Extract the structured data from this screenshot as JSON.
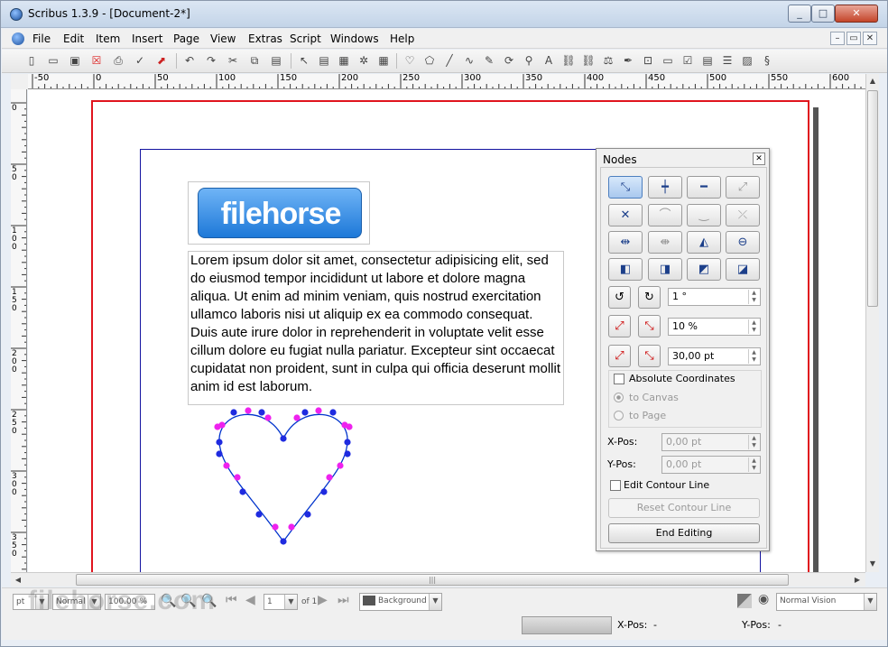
{
  "window": {
    "title": "Scribus 1.3.9 - [Document-2*]",
    "controls": [
      "_",
      "□",
      "✕"
    ]
  },
  "menubar": {
    "items": [
      "File",
      "Edit",
      "Item",
      "Insert",
      "Page",
      "View",
      "Extras",
      "Script",
      "Windows",
      "Help"
    ],
    "mdi": [
      "–",
      "▭",
      "✕"
    ]
  },
  "toolbar": {
    "icons": [
      "new-icon",
      "open-icon",
      "save-icon",
      "close-icon",
      "print-icon",
      "preflight-icon",
      "pdf-icon",
      "undo-icon",
      "redo-icon",
      "cut-icon",
      "copy-icon",
      "paste-icon",
      "select-icon",
      "text-frame-icon",
      "image-frame-icon",
      "render-frame-icon",
      "table-icon",
      "shape-icon",
      "polygon-icon",
      "line-icon",
      "bezier-icon",
      "freehand-icon",
      "rotate-icon",
      "zoom-icon",
      "edit-text-icon",
      "link-icon",
      "unlink-icon",
      "measure-icon",
      "eyedropper-icon",
      "pdf-button-icon",
      "pdf-textfield-icon",
      "pdf-checkbox-icon",
      "pdf-combo-icon",
      "pdf-list-icon",
      "pdf-annotation-icon",
      "pdf-link-icon"
    ]
  },
  "ruler": {
    "h_labels": [
      "-50",
      "0",
      "50",
      "100",
      "150",
      "200",
      "250",
      "300",
      "350",
      "400",
      "450",
      "500",
      "550",
      "600"
    ],
    "v_labels": [
      "0",
      "50",
      "100",
      "150",
      "200",
      "250",
      "300",
      "350"
    ]
  },
  "document": {
    "text": "Lorem ipsum dolor sit amet, consectetur adipisicing elit, sed do eiusmod tempor incididunt ut labore et dolore magna aliqua. Ut enim ad minim veniam, quis nostrud exercitation ullamco laboris nisi ut aliquip ex ea commodo consequat. Duis aute irure dolor in reprehenderit in voluptate velit esse cillum dolore eu fugiat nulla pariatur. Excepteur sint occaecat cupidatat non proident, sunt in culpa qui officia deserunt mollit anim id est laborum.",
    "logo_text": "filehorse"
  },
  "nodes_panel": {
    "title": "Nodes",
    "rotate_value": "1 °",
    "scale_value": "10 %",
    "size_value": "30,00 pt",
    "absolute_coords": "Absolute Coordinates",
    "to_canvas": "to Canvas",
    "to_page": "to Page",
    "xpos_label": "X-Pos:",
    "ypos_label": "Y-Pos:",
    "xpos_value": "0,00 pt",
    "ypos_value": "0,00 pt",
    "edit_contour": "Edit Contour Line",
    "reset_contour": "Reset Contour Line",
    "end_editing": "End Editing"
  },
  "statusbar": {
    "unit": "pt",
    "quality": "Normal",
    "zoom": "100.00 %",
    "page": "1",
    "of": "of 1",
    "layer": "Background",
    "vision": "Normal Vision",
    "xpos_label": "X-Pos:",
    "xpos_value": "-",
    "ypos_label": "Y-Pos:",
    "ypos_value": "-"
  },
  "watermark": "filehorse.com",
  "colors": {
    "page_border": "#e0141e",
    "margin": "#1212a0",
    "path": "#0033cc",
    "node_point": "#1f2be0",
    "control_point": "#ee22ee"
  }
}
